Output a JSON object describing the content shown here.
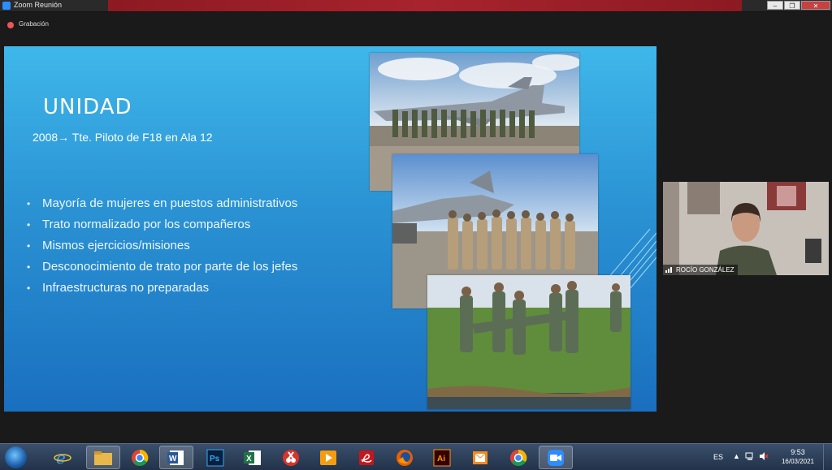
{
  "window": {
    "title": "Zoom Reunión",
    "buttons": [
      "–",
      "❐",
      "✕"
    ]
  },
  "recording": {
    "label": "Grabación"
  },
  "slide": {
    "title": "UNIDAD",
    "subtitle": "2008→ Tte. Piloto de F18 en Ala 12",
    "bullets": [
      "Mayoría de mujeres en puestos administrativos",
      "Trato normalizado por los compañeros",
      "Mismos ejercicios/misiones",
      "Desconocimiento de trato por parte de los jefes",
      "Infraestructuras no preparadas"
    ]
  },
  "participant": {
    "name": "ROCÍO GONZÁLEZ"
  },
  "taskbar": {
    "apps": [
      "start-orb",
      "internet-explorer",
      "file-explorer",
      "chrome",
      "word",
      "photoshop",
      "excel",
      "snipping-tool",
      "media-player",
      "acrobat-reader",
      "firefox",
      "illustrator",
      "outlook",
      "chrome-2",
      "zoom"
    ],
    "language": "ES",
    "time": "9:53",
    "date": "16/03/2021"
  },
  "colors": {
    "slide_top": "#3fb7ea",
    "slide_bottom": "#1a6fbf",
    "zoom_blue": "#2d8cff",
    "title_red": "#a8232d"
  }
}
